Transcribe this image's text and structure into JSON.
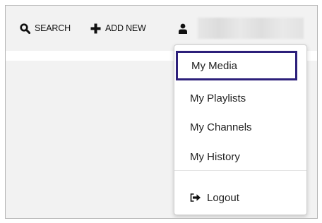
{
  "header": {
    "search_label": "SEARCH",
    "add_new_label": "ADD NEW",
    "search_icon": "search-icon",
    "add_icon": "plus-icon",
    "user_icon": "user-icon"
  },
  "user_menu": {
    "items": [
      {
        "label": "My Media",
        "selected": true
      },
      {
        "label": "My Playlists",
        "selected": false
      },
      {
        "label": "My Channels",
        "selected": false
      },
      {
        "label": "My History",
        "selected": false
      }
    ],
    "logout_label": "Logout",
    "logout_icon": "sign-out-icon"
  },
  "colors": {
    "highlight_border": "#2c1f7a",
    "header_background": "#f2f2f2"
  }
}
